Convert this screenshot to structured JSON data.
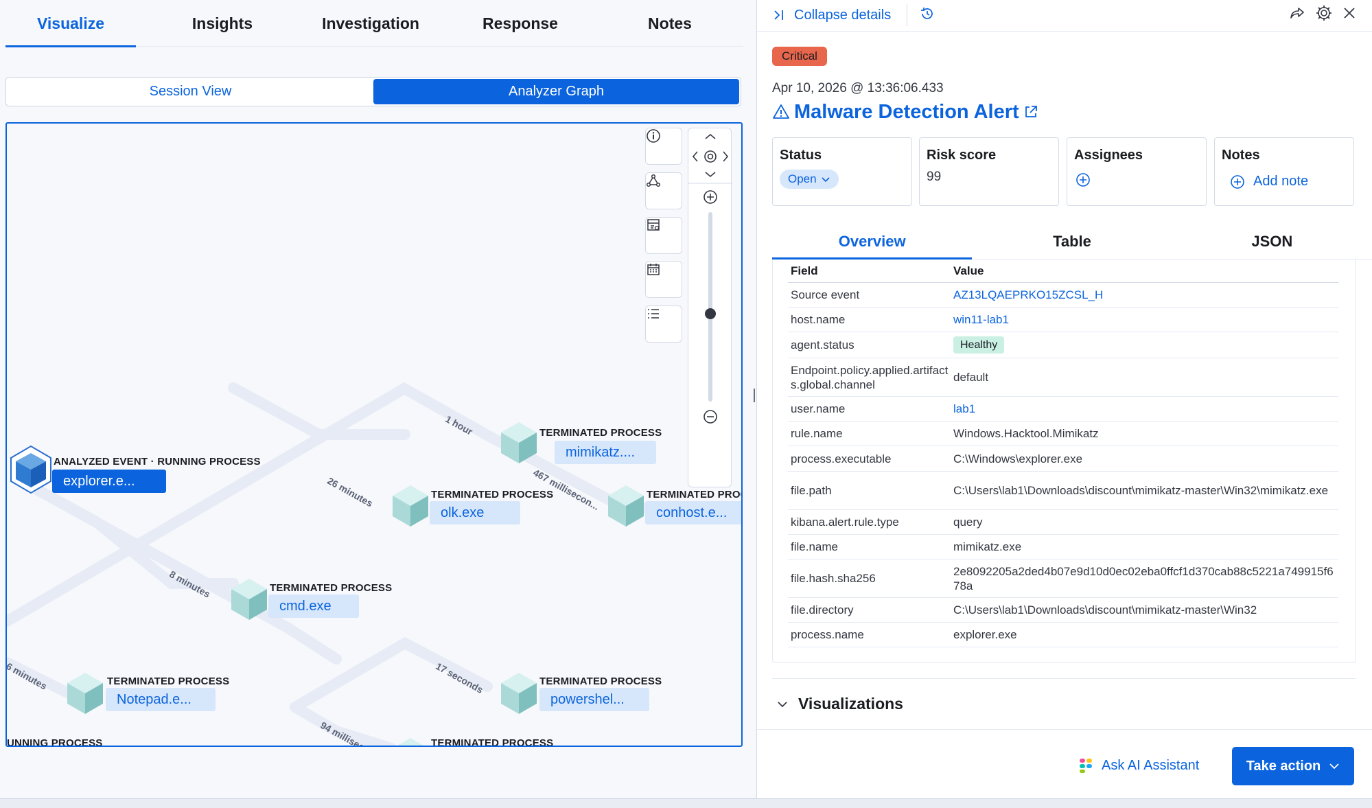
{
  "main_tabs": [
    "Visualize",
    "Insights",
    "Investigation",
    "Response",
    "Notes"
  ],
  "view_toggle": {
    "session": "Session View",
    "analyzer": "Analyzer Graph"
  },
  "graph": {
    "nodes": [
      {
        "kind": "ANALYZED EVENT · RUNNING PROCESS",
        "name": "explorer.e..."
      },
      {
        "kind": "TERMINATED PROCESS",
        "name": "mimikatz...."
      },
      {
        "kind": "TERMINATED PROCESS",
        "name": "olk.exe"
      },
      {
        "kind": "TERMINATED PROC",
        "name": "conhost.e..."
      },
      {
        "kind": "TERMINATED PROCESS",
        "name": "cmd.exe"
      },
      {
        "kind": "TERMINATED PROCESS",
        "name": "Notepad.e..."
      },
      {
        "kind": "TERMINATED PROCESS",
        "name": "powershel..."
      },
      {
        "kind": "TERMINATED PROCESS",
        "name": ""
      },
      {
        "kind": "UNNING PROCESS",
        "name": ""
      }
    ],
    "edges": [
      "1 hour",
      "26 minutes",
      "467 millisecon...",
      "8 minutes",
      "6 minutes",
      "17 seconds",
      "94 millisec..."
    ]
  },
  "panel": {
    "collapse_label": "Collapse details",
    "severity": "Critical",
    "timestamp": "Apr 10, 2026 @ 13:36:06.433",
    "title": "Malware Detection Alert",
    "cards": {
      "status_title": "Status",
      "status_value": "Open",
      "risk_title": "Risk score",
      "risk_value": "99",
      "assignees_title": "Assignees",
      "notes_title": "Notes",
      "add_note": "Add note"
    },
    "tabs": [
      "Overview",
      "Table",
      "JSON"
    ],
    "table": {
      "headers": [
        "Field",
        "Value"
      ],
      "rows": [
        {
          "field": "Source event",
          "value": "AZ13LQAEPRKO15ZCSL_H",
          "link": true
        },
        {
          "field": "host.name",
          "value": "win11-lab1",
          "link": true
        },
        {
          "field": "agent.status",
          "value": "Healthy",
          "badge": true
        },
        {
          "field": "Endpoint.policy.applied.artifacts.global.channel",
          "value": "default"
        },
        {
          "field": "user.name",
          "value": "lab1",
          "link": true
        },
        {
          "field": "rule.name",
          "value": "Windows.Hacktool.Mimikatz"
        },
        {
          "field": "process.executable",
          "value": "C:\\Windows\\explorer.exe"
        },
        {
          "field": "file.path",
          "value": "C:\\Users\\lab1\\Downloads\\discount\\mimikatz-master\\Win32\\mimikatz.exe"
        },
        {
          "field": "kibana.alert.rule.type",
          "value": "query"
        },
        {
          "field": "file.name",
          "value": "mimikatz.exe"
        },
        {
          "field": "file.hash.sha256",
          "value": "2e8092205a2ded4b07e9d10d0ec02eba0ffcf1d370cab88c5221a749915f678a"
        },
        {
          "field": "file.directory",
          "value": "C:\\Users\\lab1\\Downloads\\discount\\mimikatz-master\\Win32"
        },
        {
          "field": "process.name",
          "value": "explorer.exe"
        }
      ]
    },
    "visualizations": "Visualizations",
    "ask_ai": "Ask AI Assistant",
    "take_action": "Take action"
  },
  "colors": {
    "accent": "#0b64dd",
    "critical": "#e7664c",
    "healthy": "#c9f0e3",
    "pill": "#d6e6fb"
  },
  "icons": [
    "info-icon",
    "graph-nodes-icon",
    "schema-icon",
    "calendar-icon",
    "list-icon",
    "pan-target-icon",
    "zoom-in-icon",
    "zoom-out-icon",
    "share-icon",
    "gear-icon",
    "close-icon",
    "history-icon",
    "warning-icon",
    "external-link-icon",
    "plus-circle-icon",
    "chevron-down-icon",
    "ai-assistant-icon"
  ]
}
